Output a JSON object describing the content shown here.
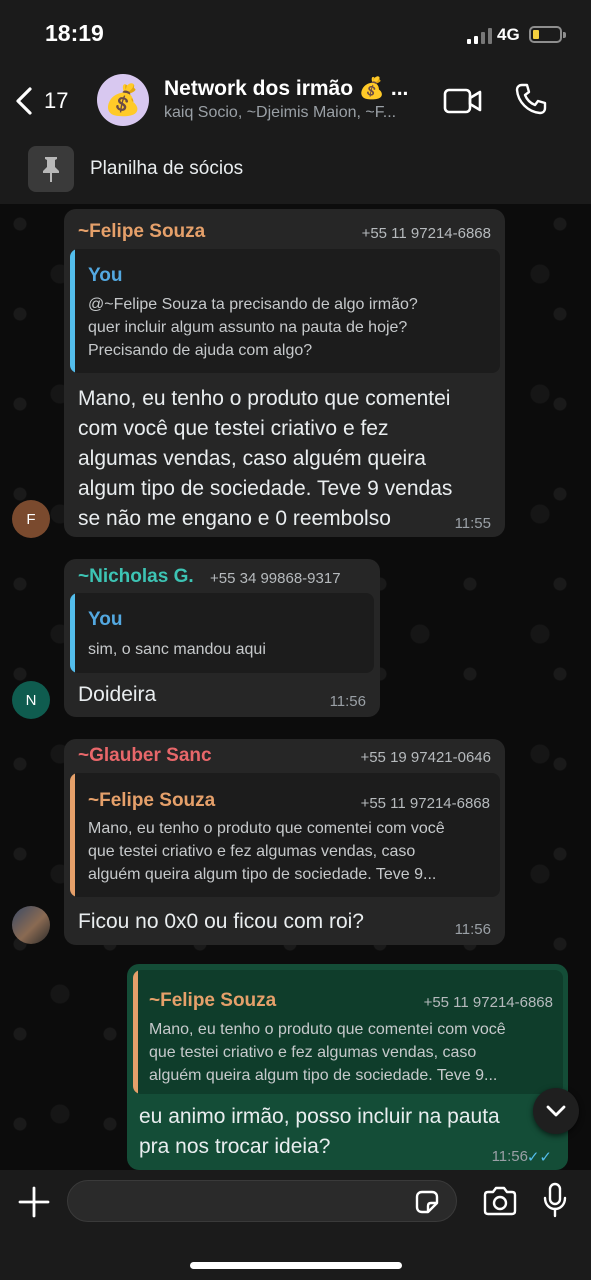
{
  "status_bar": {
    "time": "18:19",
    "network": "4G"
  },
  "header": {
    "back_count": "17",
    "group_avatar_emoji": "💰",
    "group_title": "Network dos irmão 💰 ...",
    "group_members": "kaiq Socio, ~Djeimis Maion, ~F...",
    "pinned_text": "Planilha de sócios"
  },
  "messages": [
    {
      "sender": "~Felipe Souza",
      "sender_color": "#e5a06a",
      "phone": "+55 11 97214-6868",
      "quote": {
        "author": "You",
        "author_color": "#53a8e0",
        "bar_color": "#53bdeb",
        "text": [
          "@~Felipe Souza ta precisando de algo irmão?",
          "quer incluir algum assunto na pauta de hoje?",
          "Precisando de ajuda com algo?"
        ]
      },
      "body": [
        "Mano, eu tenho o produto que comentei",
        "com você que testei criativo e fez",
        "algumas vendas, caso alguém queira",
        "algum tipo de sociedade. Teve 9 vendas",
        "se não me engano e 0 reembolso"
      ],
      "time": "11:55",
      "avatar_letter": "F",
      "avatar_color": "#7a4a2e"
    },
    {
      "sender": "~Nicholas G.",
      "sender_color": "#3dc4b4",
      "phone": "+55 34 99868-9317",
      "quote": {
        "author": "You",
        "author_color": "#53a8e0",
        "bar_color": "#53bdeb",
        "text": [
          "sim, o sanc mandou aqui"
        ]
      },
      "body": [
        "Doideira"
      ],
      "time": "11:56",
      "avatar_letter": "N",
      "avatar_color": "#0f5c4f"
    },
    {
      "sender": "~Glauber Sanc",
      "sender_color": "#e8676a",
      "phone": "+55 19 97421-0646",
      "quote": {
        "author": "~Felipe Souza",
        "author_color": "#e5a06a",
        "bar_color": "#e5a06a",
        "phone": "+55 11 97214-6868",
        "text": [
          "Mano, eu tenho o produto que comentei com você",
          "que testei criativo e fez algumas vendas, caso",
          "alguém queira algum tipo de sociedade. Teve 9..."
        ]
      },
      "body": [
        "Ficou no 0x0 ou ficou com roi?"
      ],
      "time": "11:56"
    },
    {
      "outgoing": true,
      "quote": {
        "author": "~Felipe Souza",
        "author_color": "#e5a06a",
        "bar_color": "#e5a06a",
        "phone": "+55 11 97214-6868",
        "text": [
          "Mano, eu tenho o produto que comentei com você",
          "que testei criativo e fez algumas vendas, caso",
          "alguém queira algum tipo de sociedade. Teve 9..."
        ]
      },
      "body": [
        "eu animo irmão, posso incluir na pauta",
        "pra nos trocar ideia?"
      ],
      "time": "11:56",
      "ticks": "✓✓"
    }
  ]
}
